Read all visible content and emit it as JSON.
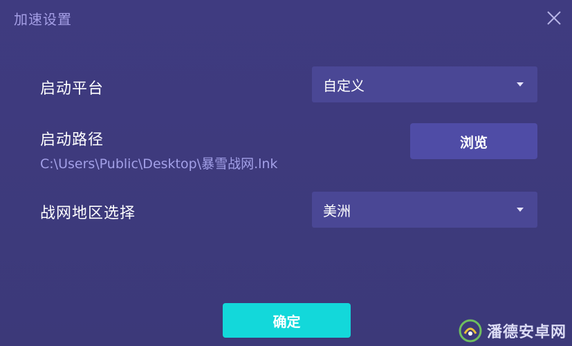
{
  "dialog": {
    "title": "加速设置"
  },
  "platform": {
    "label": "启动平台",
    "selected": "自定义"
  },
  "path": {
    "label": "启动路径",
    "value": "C:\\Users\\Public\\Desktop\\暴雪战网.lnk",
    "browse_label": "浏览"
  },
  "region": {
    "label": "战网地区选择",
    "selected": "美洲"
  },
  "footer": {
    "confirm_label": "确定"
  },
  "watermark": {
    "text": "潘德安卓网"
  },
  "colors": {
    "background": "#3d3a7c",
    "select_bg": "#4a4795",
    "browse_bg": "#4f4ca6",
    "confirm_bg": "#13d8da",
    "title": "#a59fe6",
    "path_text": "#a3a0e8"
  },
  "icons": {
    "close": "close-icon",
    "dropdown": "chevron-down-icon",
    "watermark_logo": "watermark-logo-icon"
  }
}
